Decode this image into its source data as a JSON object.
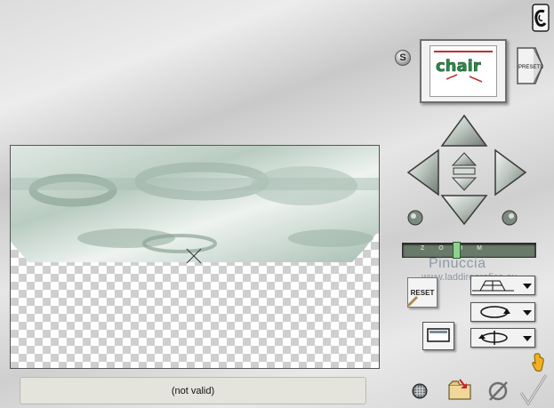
{
  "colors": {
    "accent_green": "#8fd18f",
    "canvas_texture": "#a9bdb3",
    "status_bg": "#e4e4dc",
    "watermark": "#8e9aa6"
  },
  "logo": {
    "icon": "eye-candy-logo-icon"
  },
  "side_toggle": {
    "label": "S"
  },
  "preset_preview": {
    "text": "chair"
  },
  "presets_button": {
    "label": "PRESETS"
  },
  "zoom": {
    "label": "ZOOM",
    "level": 0.4
  },
  "watermark": {
    "line1": "Pinuccia",
    "line2": "www.laddiregrafica.eu"
  },
  "reset_button": {
    "label": "RESET"
  },
  "dropdowns": [
    {
      "icon": "perspective-grid-icon"
    },
    {
      "icon": "rotate-icon"
    },
    {
      "icon": "flip-icon"
    }
  ],
  "status": {
    "text": "(not valid)"
  },
  "bottom_bar": {
    "grid": "grid-toggle-icon",
    "open": "open-folder-icon",
    "cancel": "cancel-icon",
    "ok": "ok-check-icon"
  },
  "help": "help-hand-icon"
}
